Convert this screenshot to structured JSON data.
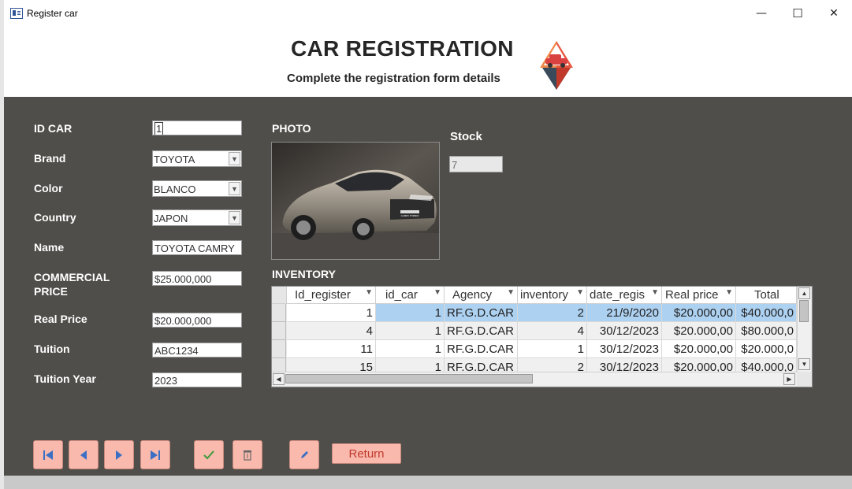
{
  "window": {
    "title": "Register car",
    "minimize": "—",
    "maximize": "☐",
    "close": "✕"
  },
  "header": {
    "title": "CAR REGISTRATION",
    "subtitle": "Complete the registration form details"
  },
  "form": {
    "id_car": {
      "label": "ID CAR",
      "value": "1"
    },
    "brand": {
      "label": "Brand",
      "value": "TOYOTA"
    },
    "color": {
      "label": "Color",
      "value": "BLANCO"
    },
    "country": {
      "label": "Country",
      "value": "JAPON"
    },
    "name": {
      "label": "Name",
      "value": "TOYOTA CAMRY"
    },
    "commercial_price": {
      "label1": "COMMERCIAL",
      "label2": "PRICE",
      "value": "$25.000,000"
    },
    "real_price": {
      "label": "Real Price",
      "value": "$20.000,000"
    },
    "tuition": {
      "label": "Tuition",
      "value": "ABC1234"
    },
    "tuition_year": {
      "label": "Tuition Year",
      "value": "2023"
    }
  },
  "photo": {
    "label": "PHOTO",
    "car_badge": "CAMRY HYBRID"
  },
  "stock": {
    "label": "Stock",
    "value": "7"
  },
  "inventory": {
    "label": "INVENTORY",
    "columns": [
      "Id_register",
      "id_car",
      "Agency",
      "inventory",
      "date_regis",
      "Real price",
      "Total"
    ],
    "rows": [
      [
        "1",
        "1",
        "RF.G.D.CAR",
        "2",
        "21/9/2020",
        "$20.000,00",
        "$40.000,0"
      ],
      [
        "4",
        "1",
        "RF.G.D.CAR",
        "4",
        "30/12/2023",
        "$20.000,00",
        "$80.000,0"
      ],
      [
        "11",
        "1",
        "RF.G.D.CAR",
        "1",
        "30/12/2023",
        "$20.000,00",
        "$20.000,0"
      ],
      [
        "15",
        "1",
        "RF.G.D.CAR",
        "2",
        "30/12/2023",
        "$20.000,00",
        "$40.000,0"
      ]
    ]
  },
  "buttons": {
    "return_label": "Return"
  },
  "icons": {
    "first": "first-record-icon",
    "prev": "previous-record-icon",
    "next": "next-record-icon",
    "last": "last-record-icon",
    "save": "check-icon",
    "delete": "trash-icon",
    "edit": "pencil-icon"
  },
  "colors": {
    "panel": "#504e4a",
    "button": "#f9b9ad",
    "selection": "#add1f0",
    "return_text": "#c0392b"
  }
}
